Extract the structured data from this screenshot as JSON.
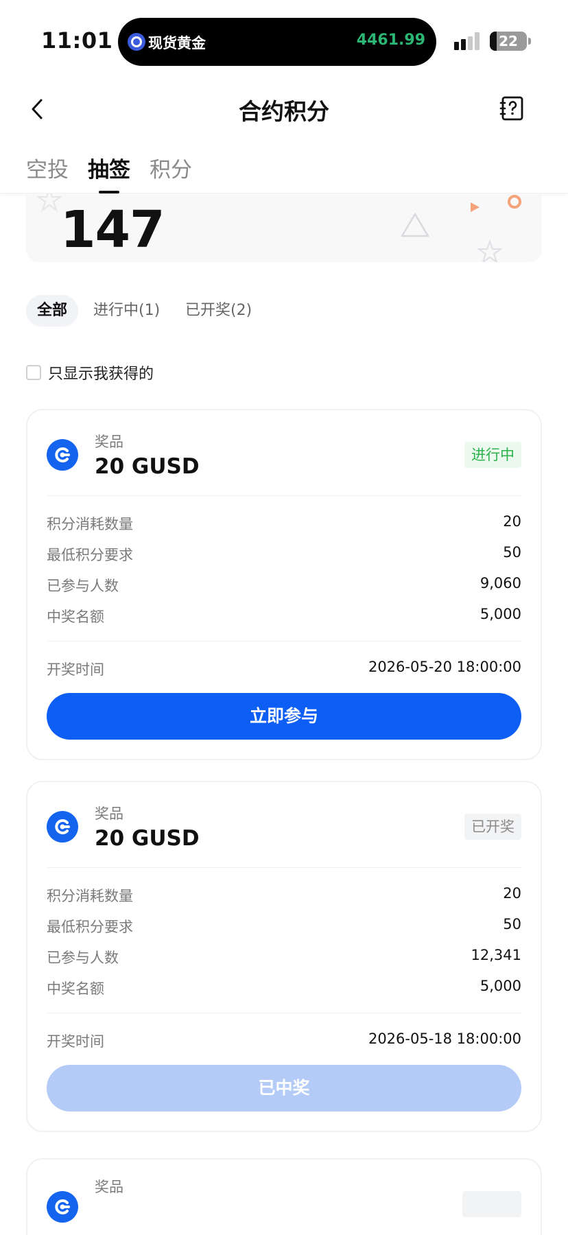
{
  "status_bar": {
    "time": "11:01",
    "island_name": "现货黄金",
    "island_price": "4461.99",
    "battery": "22"
  },
  "nav": {
    "title": "合约积分"
  },
  "tabs": [
    "空投",
    "抽签",
    "积分"
  ],
  "active_tab": "抽签",
  "points": {
    "value": "147"
  },
  "filters": [
    "全部",
    "进行中(1)",
    "已开奖(2)"
  ],
  "only_mine_label": "只显示我获得的",
  "cards": [
    {
      "prize_label": "奖品",
      "prize_name": "20 GUSD",
      "status": "进行中",
      "rows": [
        {
          "k": "积分消耗数量",
          "v": "20"
        },
        {
          "k": "最低积分要求",
          "v": "50"
        },
        {
          "k": "已参与人数",
          "v": "9,060"
        },
        {
          "k": "中奖名额",
          "v": "5,000"
        }
      ],
      "draw_time_label": "开奖时间",
      "draw_time": "2026-05-20 18:00:00",
      "button": "立即参与"
    },
    {
      "prize_label": "奖品",
      "prize_name": "20 GUSD",
      "status": "已开奖",
      "rows": [
        {
          "k": "积分消耗数量",
          "v": "20"
        },
        {
          "k": "最低积分要求",
          "v": "50"
        },
        {
          "k": "已参与人数",
          "v": "12,341"
        },
        {
          "k": "中奖名额",
          "v": "5,000"
        }
      ],
      "draw_time_label": "开奖时间",
      "draw_time": "2026-05-18 18:00:00",
      "button": "已中奖"
    },
    {
      "prize_label": "奖品"
    }
  ],
  "colors": {
    "primary": "#0d5ef5",
    "primary_disabled": "#b4cbf8",
    "live_green": "#2ab14b",
    "island_price_green": "#2bb673"
  },
  "icons": {
    "back": "chevron-left-icon",
    "help": "help-book-icon",
    "coin": "gusd-coin-icon"
  }
}
